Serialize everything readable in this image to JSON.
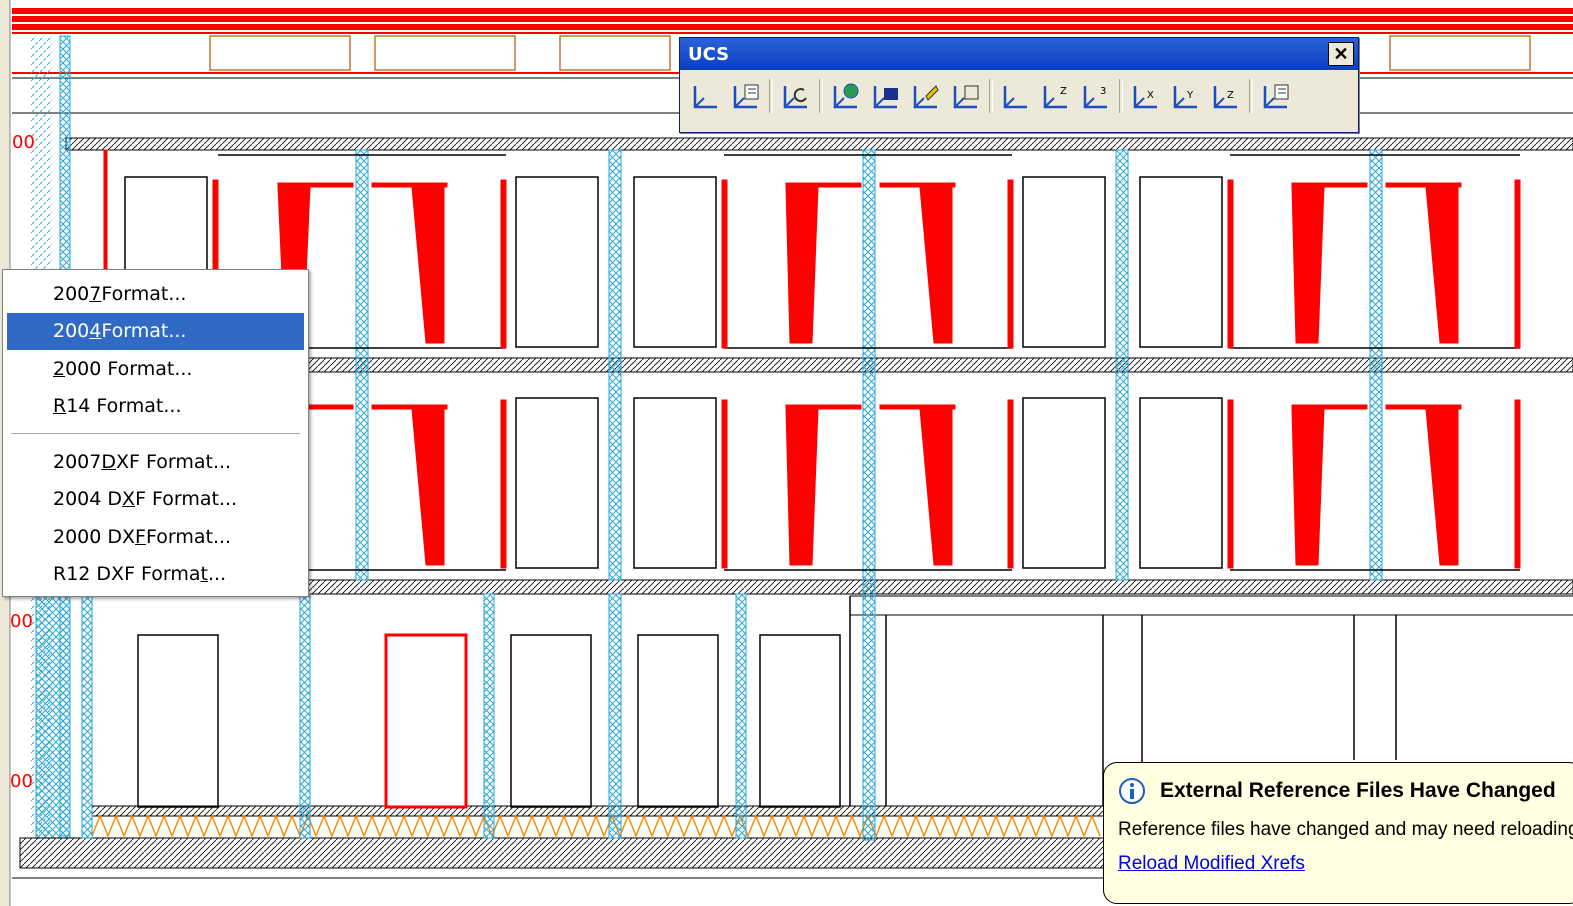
{
  "ucs_toolbar": {
    "title": "UCS",
    "close_glyph": "✕",
    "buttons": [
      {
        "name": "ucs-icon",
        "group": 1
      },
      {
        "name": "display-ucs-dialog-icon",
        "group": 1
      },
      {
        "name": "ucs-previous-icon",
        "group": 2
      },
      {
        "name": "world-ucs-icon",
        "group": 3
      },
      {
        "name": "object-ucs-icon",
        "group": 3
      },
      {
        "name": "face-ucs-icon",
        "group": 3
      },
      {
        "name": "view-ucs-icon",
        "group": 3
      },
      {
        "name": "origin-ucs-icon",
        "group": 4
      },
      {
        "name": "z-axis-vector-ucs-icon",
        "group": 4
      },
      {
        "name": "3-point-ucs-icon",
        "group": 4
      },
      {
        "name": "x-axis-rotate-ucs-icon",
        "group": 5
      },
      {
        "name": "y-axis-rotate-ucs-icon",
        "group": 5
      },
      {
        "name": "z-axis-rotate-ucs-icon",
        "group": 5
      },
      {
        "name": "apply-ucs-icon",
        "group": 6
      }
    ]
  },
  "format_menu": {
    "items": [
      {
        "pre": "200",
        "u": "7",
        "post": " Format...",
        "selected": false
      },
      {
        "pre": "200",
        "u": "4",
        "post": " Format...",
        "selected": true
      },
      {
        "pre": "",
        "u": "2",
        "post": "000 Format...",
        "selected": false
      },
      {
        "pre": "",
        "u": "R",
        "post": "14 Format...",
        "selected": false
      },
      {
        "separator": true
      },
      {
        "pre": "2007 ",
        "u": "D",
        "post": "XF Format...",
        "selected": false
      },
      {
        "pre": "2004 D",
        "u": "X",
        "post": "F Format...",
        "selected": false
      },
      {
        "pre": "2000 DX",
        "u": "F",
        "post": " Format...",
        "selected": false
      },
      {
        "pre": "R12 DXF Forma",
        "u": "t",
        "post": "...",
        "selected": false
      }
    ]
  },
  "xref_balloon": {
    "title": "External Reference Files Have Changed",
    "text": "Reference files have changed and may need reloading.",
    "link": "Reload Modified Xrefs"
  },
  "colors": {
    "drawing_red": "#ff0000",
    "hatch_blue": "#2aa7d6",
    "insulation_orange": "#ff8c00",
    "menu_highlight": "#316ac5",
    "toolbar_title": "#0b3fbf",
    "balloon_bg": "#ffffe1"
  }
}
